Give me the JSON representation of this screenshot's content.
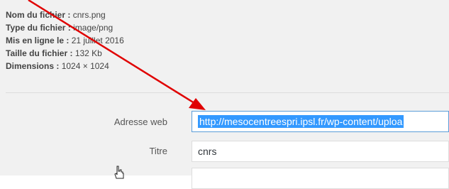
{
  "file_info": {
    "rows": [
      {
        "label": "Nom du fichier :",
        "value": "cnrs.png"
      },
      {
        "label": "Type du fichier :",
        "value": "image/png"
      },
      {
        "label": "Mis en ligne le :",
        "value": "21 juillet 2016"
      },
      {
        "label": "Taille du fichier :",
        "value": "132 Kb"
      },
      {
        "label": "Dimensions :",
        "value": "1024 × 1024"
      }
    ]
  },
  "fields": {
    "url_label": "Adresse web",
    "url_value": "http://mesocentreespri.ipsl.fr/wp-content/uploa",
    "title_label": "Titre",
    "title_value": "cnrs",
    "alt_label": "",
    "alt_value": ""
  },
  "colors": {
    "annotation_arrow": "#e00000",
    "selection": "#3399ff"
  },
  "icons": {
    "cursor": "hand-pointer-icon"
  }
}
